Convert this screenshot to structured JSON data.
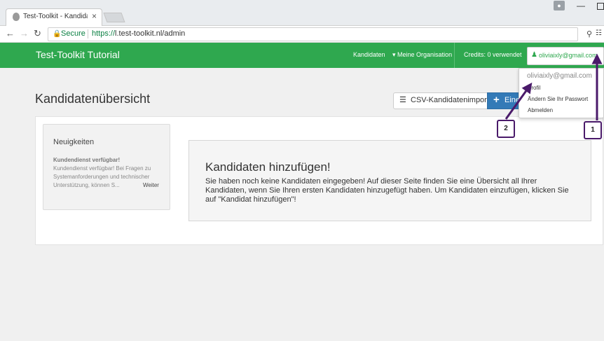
{
  "browser": {
    "tab_title": "Test-Toolkit - Kandidaten",
    "tab_close": "×",
    "secure_label": "Secure",
    "url_protocol": "https://",
    "url_rest": "l.test-toolkit.nl/admin"
  },
  "navbar": {
    "brand": "Test-Toolkit Tutorial",
    "kandidaten": "Kandidaten",
    "organisation": "Meine Organisation",
    "credits": "Credits: 0 verwendet",
    "user_email": "oliviaixly@gmail.com"
  },
  "main": {
    "page_title": "Kandidatenübersicht",
    "csv_button": "CSV-Kandidatenimport",
    "add_button": "Eine"
  },
  "news": {
    "title": "Neuigkeiten",
    "item_title": "Kundendienst verfügbar!",
    "item_text": "Kundendienst verfügbar! Bei Fragen zu Systemanforderungen und technischer Unterstützung, können S...",
    "more_link": "Weiter"
  },
  "empty_state": {
    "title": "Kandidaten hinzufügen!",
    "text": "Sie haben noch keine Kandidaten eingegeben! Auf dieser Seite finden Sie eine Übersicht all Ihrer Kandidaten, wenn Sie Ihren ersten Kandidaten hinzugefügt haben. Um Kandidaten einzufügen, klicken Sie auf \"Kandidat hinzufügen\"!"
  },
  "dropdown": {
    "email": "oliviaixly@gmail.com",
    "items": [
      "Profil",
      "Ändern Sie Ihr Passwort",
      "Abmelden"
    ]
  },
  "annotations": {
    "callout_1": "1",
    "callout_2": "2",
    "color": "#4a1a6a"
  },
  "colors": {
    "brand_green": "#2fa84f",
    "primary_blue": "#337ab7"
  },
  "icons": [
    "shield-icon",
    "lock-icon",
    "user-icon",
    "list-icon",
    "plus-icon",
    "key-icon",
    "translate-icon",
    "caret-down-icon"
  ]
}
